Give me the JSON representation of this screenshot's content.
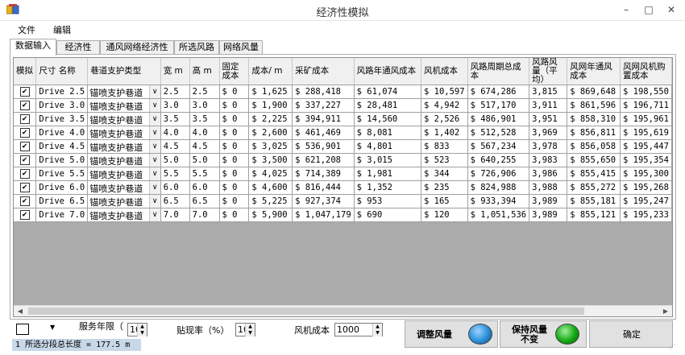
{
  "window": {
    "title": "经济性模拟",
    "minimize": "–",
    "maximize": "□",
    "close": "✕"
  },
  "menu": [
    "文件",
    "编辑"
  ],
  "tabs": [
    "数据输入",
    "经济性",
    "通风网络经济性",
    "所选风路",
    "网络风量"
  ],
  "columns": [
    "模拟",
    "尺寸 名称",
    "巷道支护类型",
    "宽 m",
    "高 m",
    "固定 成本",
    "成本/ m",
    "采矿成本",
    "风路年通风成本",
    "风机成本",
    "风路周期总成本",
    "风路风量（平均）",
    "风网年通风成本",
    "风网风机购置成本"
  ],
  "rows": [
    {
      "checked": true,
      "name": "Drive 2.5",
      "support": "锚喷支护巷道",
      "width": "2.5",
      "height": "2.5",
      "fixed": "$ 0",
      "cost_m": "$ 1,625",
      "mining": "$ 288,418",
      "vent": "$ 61,074",
      "fan": "$ 10,597",
      "total": "$ 674,286",
      "airflow": "3,815",
      "net_vent": "$ 869,648",
      "net_fan": "$ 198,550"
    },
    {
      "checked": true,
      "name": "Drive 3.0",
      "support": "锚喷支护巷道",
      "width": "3.0",
      "height": "3.0",
      "fixed": "$ 0",
      "cost_m": "$ 1,900",
      "mining": "$ 337,227",
      "vent": "$ 28,481",
      "fan": "$ 4,942",
      "total": "$ 517,170",
      "airflow": "3,911",
      "net_vent": "$ 861,596",
      "net_fan": "$ 196,711"
    },
    {
      "checked": true,
      "name": "Drive 3.5",
      "support": "锚喷支护巷道",
      "width": "3.5",
      "height": "3.5",
      "fixed": "$ 0",
      "cost_m": "$ 2,225",
      "mining": "$ 394,911",
      "vent": "$ 14,560",
      "fan": "$ 2,526",
      "total": "$ 486,901",
      "airflow": "3,951",
      "net_vent": "$ 858,310",
      "net_fan": "$ 195,961"
    },
    {
      "checked": true,
      "name": "Drive 4.0",
      "support": "锚喷支护巷道",
      "width": "4.0",
      "height": "4.0",
      "fixed": "$ 0",
      "cost_m": "$ 2,600",
      "mining": "$ 461,469",
      "vent": "$ 8,081",
      "fan": "$ 1,402",
      "total": "$ 512,528",
      "airflow": "3,969",
      "net_vent": "$ 856,811",
      "net_fan": "$ 195,619"
    },
    {
      "checked": true,
      "name": "Drive 4.5",
      "support": "锚喷支护巷道",
      "width": "4.5",
      "height": "4.5",
      "fixed": "$ 0",
      "cost_m": "$ 3,025",
      "mining": "$ 536,901",
      "vent": "$ 4,801",
      "fan": "$ 833",
      "total": "$ 567,234",
      "airflow": "3,978",
      "net_vent": "$ 856,058",
      "net_fan": "$ 195,447"
    },
    {
      "checked": true,
      "name": "Drive 5.0",
      "support": "锚喷支护巷道",
      "width": "5.0",
      "height": "5.0",
      "fixed": "$ 0",
      "cost_m": "$ 3,500",
      "mining": "$ 621,208",
      "vent": "$ 3,015",
      "fan": "$ 523",
      "total": "$ 640,255",
      "airflow": "3,983",
      "net_vent": "$ 855,650",
      "net_fan": "$ 195,354"
    },
    {
      "checked": true,
      "name": "Drive 5.5",
      "support": "锚喷支护巷道",
      "width": "5.5",
      "height": "5.5",
      "fixed": "$ 0",
      "cost_m": "$ 4,025",
      "mining": "$ 714,389",
      "vent": "$ 1,981",
      "fan": "$ 344",
      "total": "$ 726,906",
      "airflow": "3,986",
      "net_vent": "$ 855,415",
      "net_fan": "$ 195,300"
    },
    {
      "checked": true,
      "name": "Drive 6.0",
      "support": "锚喷支护巷道",
      "width": "6.0",
      "height": "6.0",
      "fixed": "$ 0",
      "cost_m": "$ 4,600",
      "mining": "$ 816,444",
      "vent": "$ 1,352",
      "fan": "$ 235",
      "total": "$ 824,988",
      "airflow": "3,988",
      "net_vent": "$ 855,272",
      "net_fan": "$ 195,268"
    },
    {
      "checked": true,
      "name": "Drive 6.5",
      "support": "锚喷支护巷道",
      "width": "6.5",
      "height": "6.5",
      "fixed": "$ 0",
      "cost_m": "$ 5,225",
      "mining": "$ 927,374",
      "vent": "$ 953",
      "fan": "$ 165",
      "total": "$ 933,394",
      "airflow": "3,989",
      "net_vent": "$ 855,181",
      "net_fan": "$ 195,247"
    },
    {
      "checked": true,
      "name": "Drive 7.0",
      "support": "锚喷支护巷道",
      "width": "7.0",
      "height": "7.0",
      "fixed": "$ 0",
      "cost_m": "$ 5,900",
      "mining": "$ 1,047,179",
      "vent": "$ 690",
      "fan": "$ 120",
      "total": "$ 1,051,536",
      "airflow": "3,989",
      "net_vent": "$ 855,121",
      "net_fan": "$ 195,233"
    }
  ],
  "controls": {
    "service_years_label": "服务年限（",
    "service_years": "10",
    "discount_label": "贴现率（%）",
    "discount": "10",
    "fan_cost_label": "风机成本",
    "fan_cost": "1000",
    "adjust_btn": "调整风量",
    "keep_btn_line1": "保持风量",
    "keep_btn_line2": "不变",
    "ok_btn": "确定"
  },
  "status": "1 所选分段总长度 = 177.5 m",
  "colors": {
    "led_blue": "#2a8fd8",
    "led_green": "#13a813"
  }
}
